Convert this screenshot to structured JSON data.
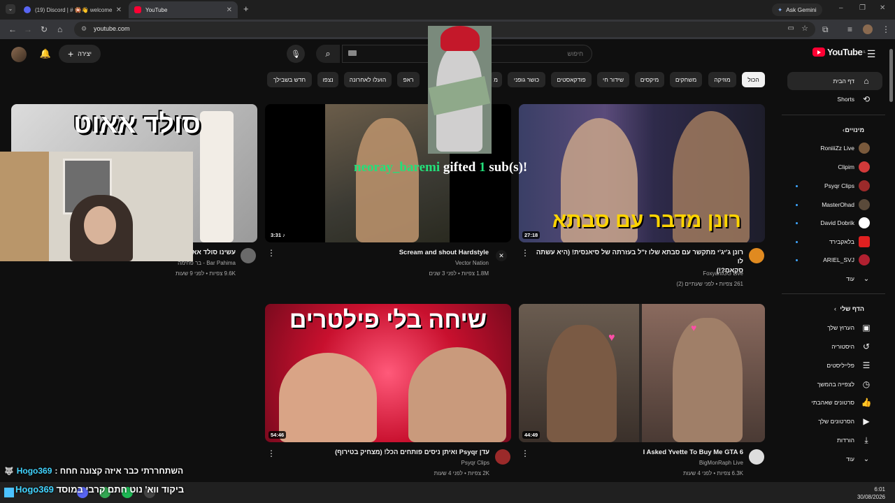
{
  "browser": {
    "tabs": [
      {
        "label": "(19) Discord | # 🎇👋 welcome",
        "active": false
      },
      {
        "label": "YouTube",
        "active": true
      }
    ],
    "new_tab": "+",
    "url": "youtube.com",
    "ask_gemini": "Ask Gemini"
  },
  "youtube": {
    "logo": "YouTube",
    "logo_sup": "IL",
    "search_placeholder": "חיפוש",
    "create_label": "יצירה",
    "chips": [
      "הכול",
      "מוזיקה",
      "משחקים",
      "מיקסים",
      "שידור חי",
      "פודקאסטים",
      "כושר גופני",
      "מ",
      "ראפ",
      "הועלו לאחרונה",
      "נצפו",
      "חדש בשבילך"
    ],
    "active_chip": "הכול",
    "sidebar": {
      "home": "דף הבית",
      "shorts": "Shorts",
      "subs_header": "מינויים",
      "channels": [
        {
          "name": "RoniiiZz Live",
          "color": "#7a5a3c",
          "dot": false
        },
        {
          "name": "Clipim",
          "color": "#d23a3a",
          "dot": false
        },
        {
          "name": "Psyqr Clips",
          "color": "#9b2a2a",
          "dot": true
        },
        {
          "name": "MasterOhad",
          "color": "#5a4a3a",
          "dot": true
        },
        {
          "name": "David Dobrik",
          "color": "#ffffff",
          "dot": true
        },
        {
          "name": "בלאקבירד",
          "color": "#e02020",
          "dot": true
        },
        {
          "name": "ARIEL_SVJ",
          "color": "#b02030",
          "dot": true
        }
      ],
      "more1": "עוד",
      "me_header": "הדף שלי",
      "me_items": [
        "הערוץ שלך",
        "היסטוריה",
        "פלייליסטים",
        "לצפייה בהמשך",
        "סרטונים שאהבתי",
        "הסרטונים שלך",
        "הורדות"
      ],
      "more2": "עוד"
    },
    "videos": [
      {
        "title_lines": [
          "רונן ג'יג'י מתקשר עם סבתא שלו ז\"ל בעזרתה של סיאנסית! (היא עשתה לו",
          "סקאם?!)"
        ],
        "channel": "FoxyantGG Live",
        "meta": "261 צפיות • לפני שעתיים (2)",
        "duration": "27:18",
        "overlay_text": "רונן מדבר עם סבתא"
      },
      {
        "title_lines": [
          "Scream and shout  Hardstyle"
        ],
        "channel": "Vector Nation",
        "meta": "1.8M צפיות • לפני 3 שנים",
        "duration": "3:31 ♪"
      },
      {
        "title_lines": [
          "עשינו סולד אאוט"
        ],
        "channel": "Bar Pahima - בר פחימה",
        "meta": "9.6K צפיות • לפני 9 שעות",
        "duration": "",
        "overlay_text": "סולד אאוט"
      },
      {
        "title_lines": [
          "I Asked Yvette To Buy Me GTA 6"
        ],
        "channel": "BigMonRaph Live",
        "meta": "6.3K צפיות • לפני 4 שעות",
        "duration": "44:49"
      },
      {
        "title_lines": [
          "עדן Psyqr ואיתן ניסים פותחים הכל! (מצחיק בטירוף)"
        ],
        "channel": "Psyqr Clips",
        "meta": "2K צפיות • לפני 4 שעות",
        "duration": "54:46",
        "overlay_text": "שיחה בלי פילטרים"
      }
    ]
  },
  "overlay": {
    "gift_user": "neoray_baremi",
    "gift_mid": "gifted",
    "gift_count": "1",
    "gift_end": "sub(s)!",
    "chat_user": "Hogo369",
    "chat_text": "השתחררתי כבר איזה קצונה חחח :",
    "ticker_user": "Hogo369",
    "ticker_text": "ביקוד ווא' נוט חתם קרבי במוסד"
  },
  "taskbar": {
    "time": "6:01",
    "date": "30/08/2026"
  }
}
